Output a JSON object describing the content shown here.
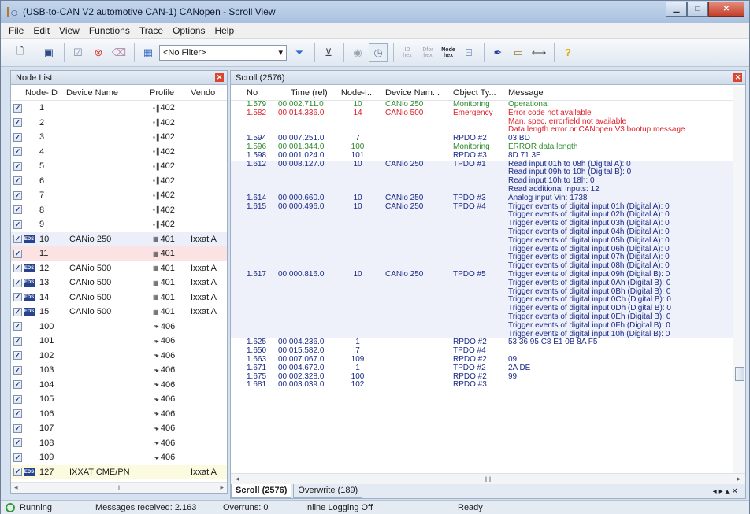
{
  "window": {
    "title": "(USB-to-CAN V2 automotive  CAN-1) CANopen - Scroll View"
  },
  "menu": [
    "File",
    "Edit",
    "View",
    "Functions",
    "Trace",
    "Options",
    "Help"
  ],
  "toolbar": {
    "filter_value": "<No Filter>",
    "id_hex_label": "ID\nhex",
    "dfor_hex_label": "Dfor\nhex",
    "node_hex_label": "Node\nhex"
  },
  "node_list": {
    "title": "Node List",
    "columns": [
      "Node-ID",
      "Device Name",
      "Profile",
      "Vendo"
    ],
    "rows": [
      {
        "id": "1",
        "name": "",
        "profile": "402",
        "vendor": "",
        "eds": false,
        "style": ""
      },
      {
        "id": "2",
        "name": "",
        "profile": "402",
        "vendor": "",
        "eds": false,
        "style": ""
      },
      {
        "id": "3",
        "name": "",
        "profile": "402",
        "vendor": "",
        "eds": false,
        "style": ""
      },
      {
        "id": "4",
        "name": "",
        "profile": "402",
        "vendor": "",
        "eds": false,
        "style": ""
      },
      {
        "id": "5",
        "name": "",
        "profile": "402",
        "vendor": "",
        "eds": false,
        "style": ""
      },
      {
        "id": "6",
        "name": "",
        "profile": "402",
        "vendor": "",
        "eds": false,
        "style": ""
      },
      {
        "id": "7",
        "name": "",
        "profile": "402",
        "vendor": "",
        "eds": false,
        "style": ""
      },
      {
        "id": "8",
        "name": "",
        "profile": "402",
        "vendor": "",
        "eds": false,
        "style": ""
      },
      {
        "id": "9",
        "name": "",
        "profile": "402",
        "vendor": "",
        "eds": false,
        "style": ""
      },
      {
        "id": "10",
        "name": "CANio 250",
        "profile": "401",
        "vendor": "Ixxat A",
        "eds": true,
        "style": "hl"
      },
      {
        "id": "11",
        "name": "",
        "profile": "401",
        "vendor": "",
        "eds": false,
        "style": "pink"
      },
      {
        "id": "12",
        "name": "CANio 500",
        "profile": "401",
        "vendor": "Ixxat A",
        "eds": true,
        "style": ""
      },
      {
        "id": "13",
        "name": "CANio 500",
        "profile": "401",
        "vendor": "Ixxat A",
        "eds": true,
        "style": ""
      },
      {
        "id": "14",
        "name": "CANio 500",
        "profile": "401",
        "vendor": "Ixxat A",
        "eds": true,
        "style": ""
      },
      {
        "id": "15",
        "name": "CANio 500",
        "profile": "401",
        "vendor": "Ixxat A",
        "eds": true,
        "style": ""
      },
      {
        "id": "100",
        "name": "",
        "profile": "406",
        "vendor": "",
        "eds": false,
        "style": ""
      },
      {
        "id": "101",
        "name": "",
        "profile": "406",
        "vendor": "",
        "eds": false,
        "style": ""
      },
      {
        "id": "102",
        "name": "",
        "profile": "406",
        "vendor": "",
        "eds": false,
        "style": ""
      },
      {
        "id": "103",
        "name": "",
        "profile": "406",
        "vendor": "",
        "eds": false,
        "style": ""
      },
      {
        "id": "104",
        "name": "",
        "profile": "406",
        "vendor": "",
        "eds": false,
        "style": ""
      },
      {
        "id": "105",
        "name": "",
        "profile": "406",
        "vendor": "",
        "eds": false,
        "style": ""
      },
      {
        "id": "106",
        "name": "",
        "profile": "406",
        "vendor": "",
        "eds": false,
        "style": ""
      },
      {
        "id": "107",
        "name": "",
        "profile": "406",
        "vendor": "",
        "eds": false,
        "style": ""
      },
      {
        "id": "108",
        "name": "",
        "profile": "406",
        "vendor": "",
        "eds": false,
        "style": ""
      },
      {
        "id": "109",
        "name": "",
        "profile": "406",
        "vendor": "",
        "eds": false,
        "style": ""
      },
      {
        "id": "127",
        "name": "IXXAT CME/PN",
        "profile": "",
        "vendor": "Ixxat A",
        "eds": true,
        "style": "yellow"
      }
    ],
    "hscroll_label": "III"
  },
  "scroll_view": {
    "title": "Scroll (2576)",
    "columns": [
      "No",
      "Time (rel)",
      "Node-I...",
      "Device Nam...",
      "Object Ty...",
      "Message"
    ],
    "rows": [
      {
        "no": "1.579",
        "time": "00.002.711.0",
        "node": "10",
        "device": "CANio 250",
        "obj": "Monitoring",
        "color": "green",
        "hl": false,
        "msg": [
          "Operational"
        ]
      },
      {
        "no": "1.582",
        "time": "00.014.336.0",
        "node": "14",
        "device": "CANio 500",
        "obj": "Emergency",
        "color": "red",
        "hl": false,
        "msg": [
          "Error code not available",
          "Man. spec. errorfield not available",
          "Data length error or CANopen V3 bootup message"
        ]
      },
      {
        "no": "1.594",
        "time": "00.007.251.0",
        "node": "7",
        "device": "",
        "obj": "RPDO #2",
        "color": "blue",
        "hl": false,
        "msg": [
          "03 BD"
        ]
      },
      {
        "no": "1.596",
        "time": "00.001.344.0",
        "node": "100",
        "device": "",
        "obj": "Monitoring",
        "color": "green",
        "hl": false,
        "msg": [
          "ERROR  data length"
        ]
      },
      {
        "no": "1.598",
        "time": "00.001.024.0",
        "node": "101",
        "device": "",
        "obj": "RPDO #3",
        "color": "blue",
        "hl": false,
        "msg": [
          "8D 71 3E"
        ]
      },
      {
        "no": "1.612",
        "time": "00.008.127.0",
        "node": "10",
        "device": "CANio 250",
        "obj": "TPDO #1",
        "color": "blue",
        "hl": true,
        "msg": [
          "Read input 01h to 08h (Digital A): 0",
          "Read input 09h to 10h (Digital B): 0",
          "Read input 10h to 18h: 0",
          "Read additional inputs: 12"
        ]
      },
      {
        "no": "1.614",
        "time": "00.000.660.0",
        "node": "10",
        "device": "CANio 250",
        "obj": "TPDO #3",
        "color": "blue",
        "hl": true,
        "msg": [
          "Analog input Vin: 1738"
        ]
      },
      {
        "no": "1.615",
        "time": "00.000.496.0",
        "node": "10",
        "device": "CANio 250",
        "obj": "TPDO #4",
        "color": "blue",
        "hl": true,
        "msg": [
          "Trigger events of digital input 01h (Digital A): 0",
          "Trigger events of digital input 02h (Digital A): 0",
          "Trigger events of digital input 03h (Digital A): 0",
          "Trigger events of digital input 04h (Digital A): 0",
          "Trigger events of digital input 05h (Digital A): 0",
          "Trigger events of digital input 06h (Digital A): 0",
          "Trigger events of digital input 07h (Digital A): 0",
          "Trigger events of digital input 08h (Digital A): 0"
        ]
      },
      {
        "no": "1.617",
        "time": "00.000.816.0",
        "node": "10",
        "device": "CANio 250",
        "obj": "TPDO #5",
        "color": "blue",
        "hl": true,
        "msg": [
          "Trigger events of digital input 09h (Digital B): 0",
          "Trigger events of digital input 0Ah (Digital B): 0",
          "Trigger events of digital input 0Bh (Digital B): 0",
          "Trigger events of digital input 0Ch (Digital B): 0",
          "Trigger events of digital input 0Dh (Digital B): 0",
          "Trigger events of digital input 0Eh (Digital B): 0",
          "Trigger events of digital input 0Fh (Digital B): 0",
          "Trigger events of digital input 10h (Digital B): 0"
        ]
      },
      {
        "no": "1.625",
        "time": "00.004.236.0",
        "node": "1",
        "device": "",
        "obj": "RPDO #2",
        "color": "blue",
        "hl": false,
        "msg": [
          "53 36 95 C8 E1 0B 8A F5"
        ]
      },
      {
        "no": "1.650",
        "time": "00.015.582.0",
        "node": "7",
        "device": "",
        "obj": "TPDO #4",
        "color": "blue",
        "hl": false,
        "msg": [
          ""
        ]
      },
      {
        "no": "1.663",
        "time": "00.007.067.0",
        "node": "109",
        "device": "",
        "obj": "RPDO #2",
        "color": "blue",
        "hl": false,
        "msg": [
          "09"
        ]
      },
      {
        "no": "1.671",
        "time": "00.004.672.0",
        "node": "1",
        "device": "",
        "obj": "TPDO #2",
        "color": "blue",
        "hl": false,
        "msg": [
          "2A DE"
        ]
      },
      {
        "no": "1.675",
        "time": "00.002.328.0",
        "node": "100",
        "device": "",
        "obj": "RPDO #2",
        "color": "blue",
        "hl": false,
        "msg": [
          "99"
        ]
      },
      {
        "no": "1.681",
        "time": "00.003.039.0",
        "node": "102",
        "device": "",
        "obj": "RPDO #3",
        "color": "blue",
        "hl": false,
        "msg": [
          ""
        ]
      }
    ],
    "hscroll_label": "III",
    "tabs": [
      "Scroll (2576)",
      "Overwrite (189)"
    ]
  },
  "status": {
    "state": "Running",
    "messages": "Messages received: 2.163",
    "overruns": "Overruns: 0",
    "logging": "Inline Logging Off",
    "ready": "Ready"
  },
  "colors": {
    "green": "#2d8a2d",
    "red": "#e0202a",
    "blue": "#1a2b86",
    "running": "#2f9b32"
  }
}
